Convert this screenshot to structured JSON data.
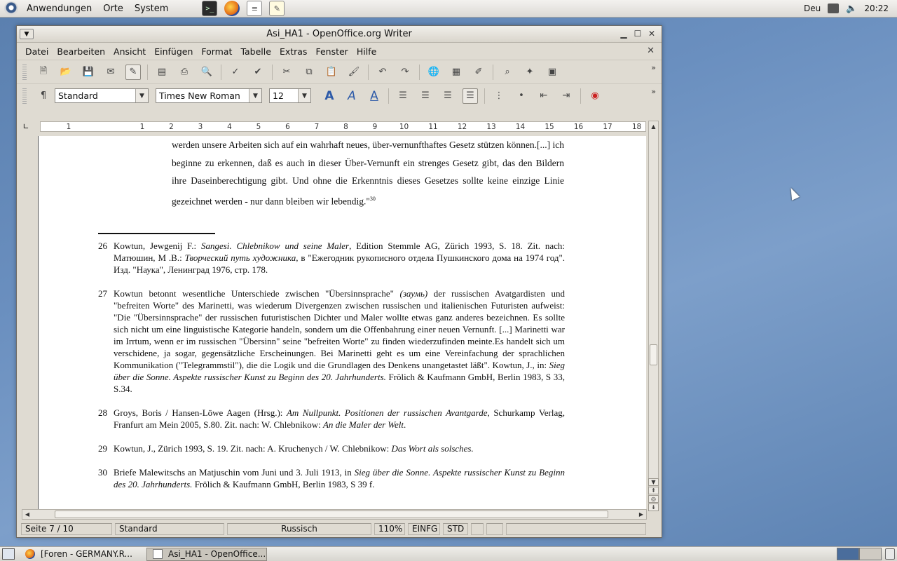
{
  "top_panel": {
    "menus": [
      "Anwendungen",
      "Orte",
      "System"
    ],
    "keyboard_layout": "Deu",
    "clock": "20:22"
  },
  "window": {
    "title": "Asi_HA1 - OpenOffice.org Writer",
    "menu": [
      "Datei",
      "Bearbeiten",
      "Ansicht",
      "Einfügen",
      "Format",
      "Tabelle",
      "Extras",
      "Fenster",
      "Hilfe"
    ]
  },
  "format_bar": {
    "paragraph_style": "Standard",
    "font_name": "Times New Roman",
    "font_size": "12"
  },
  "ruler": {
    "ticks": [
      "1",
      "1",
      "2",
      "3",
      "4",
      "5",
      "6",
      "7",
      "8",
      "9",
      "10",
      "11",
      "12",
      "13",
      "14",
      "15",
      "16",
      "17",
      "18"
    ]
  },
  "document": {
    "quote": {
      "text": "werden unsere Arbeiten sich auf ein wahrhaft neues, über-vernunfthaftes Gesetz stützen können.[...] ich beginne zu erkennen, daß es auch in dieser Über-Vernunft ein strenges Gesetz gibt, das den Bildern ihre Daseinberechtigung gibt. Und ohne die Erkenntnis dieses Gesetzes sollte keine einzige Linie gezeichnet werden - nur dann bleiben wir lebendig.\"",
      "footnote_ref": "30"
    },
    "footnotes": [
      {
        "num": "26",
        "a": "Kowtun, Jewgenij F.: ",
        "a_i": "Sangesi. Chlebnikow und seine Maler",
        "b": ", Edition Stemmle AG, Zürich 1993, S. 18. Zit. nach: Матюшин, М .В.: ",
        "b_i": "Творческий путь художника",
        "c": ", в \"Ежегодник рукописного отдела Пушкинского дома на 1974 год\". Изд. \"Наука\", Ленинград 1976, стр. 178."
      },
      {
        "num": "27",
        "a": "Kowtun betonnt  wesentliche  Unterschiede zwischen \"Übersinnsprache\" ",
        "a_i": "(заумь)",
        "b": " der russischen Avatgardisten und \"befreiten Worte\" des Marinetti, was wiederum Divergenzen zwischen russischen und italienischen Futuristen aufweist: \"Die \"Übersinnsprache\" der russischen futuristischen Dichter und Maler wollte etwas ganz anderes bezeichnen. Es sollte sich nicht um eine linguistische Kategorie handeln, sondern um die Offenbahrung einer neuen Vernunft. [...] Marinetti war im Irrtum, wenn er im russischen \"Übersinn\" seine \"befreiten Worte\" zu finden wiederzufinden meinte.Es handelt sich um verschidene, ja sogar, gegensätzliche Erscheinungen. Bei Marinetti geht es um eine Vereinfachung der sprachlichen Kommunikation (\"Telegrammstil\"), die die Logik und die Grundlagen des Denkens unangetastet läßt\". Kowtun, J., in: ",
        "b_i": "Sieg über die Sonne. Aspekte russischer Kunst zu Beginn des 20. Jahrhunderts.",
        "c": " Frölich & Kaufmann GmbH, Berlin 1983, S 33, S.34."
      },
      {
        "num": "28",
        "a": "Groys, Boris / Hansen-Löwe Aagen (Hrsg.): ",
        "a_i": "Am Nullpunkt. Positionen der russischen Avantgarde",
        "b": ", Schurkamp Verlag, Franfurt am Mein 2005, S.80. Zit. nach: W. Chlebnikow: ",
        "b_i": "An die Maler der Welt",
        "c": "."
      },
      {
        "num": "29",
        "a": "Kowtun, J., Zürich 1993, S. 19. Zit. nach: A. Kruchenych / W. Chlebnikow: ",
        "a_i": "Das Wort als solsches.",
        "b": "",
        "b_i": "",
        "c": ""
      },
      {
        "num": "30",
        "a": "Briefe Malewitschs an Matjuschin vom Juni und 3. Juli 1913, in ",
        "a_i": "Sieg über die Sonne. Aspekte russischer Kunst zu Beginn des 20. Jahrhunderts.",
        "b": " Frölich & Kaufmann GmbH, Berlin 1983, S 39 f.",
        "b_i": "",
        "c": ""
      }
    ]
  },
  "status_bar": {
    "page": "Seite 7 / 10",
    "style": "Standard",
    "language": "Russisch",
    "zoom": "110%",
    "insert_mode": "EINFG",
    "selection_mode": "STD"
  },
  "taskbar": {
    "tasks": [
      "[Foren - GERMANY.R...",
      "Asi_HA1 - OpenOffice..."
    ]
  }
}
